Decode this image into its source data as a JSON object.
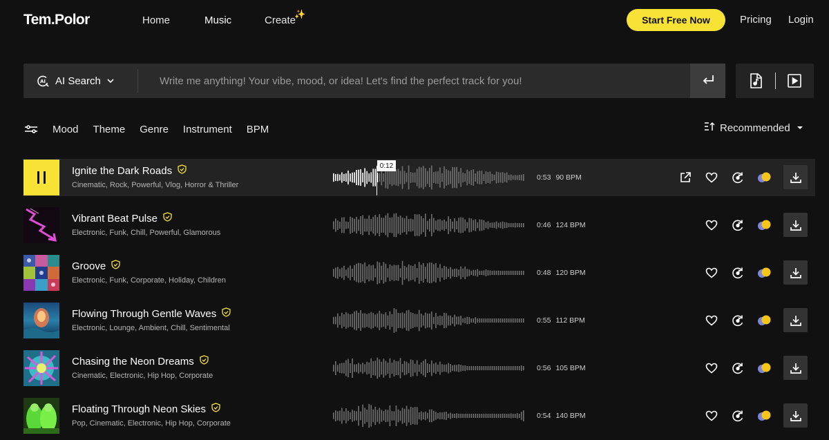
{
  "nav": {
    "logo": "Tem.Polor",
    "home": "Home",
    "music": "Music",
    "create": "Create",
    "cta": "Start Free Now",
    "pricing": "Pricing",
    "login": "Login"
  },
  "search": {
    "mode_label": "AI Search",
    "placeholder": "Write me anything! Your vibe, mood, or idea! Let's find the perfect track for you!"
  },
  "filters": [
    "Mood",
    "Theme",
    "Genre",
    "Instrument",
    "BPM"
  ],
  "sort": {
    "label": "Recommended"
  },
  "accent_color": "#f8e236",
  "player": {
    "current_time": "0:12",
    "progress": 0.23
  },
  "tracks": [
    {
      "title": "Ignite the Dark Roads",
      "tags": "Cinematic, Rock, Powerful, Vlog, Horror & Thriller",
      "duration": "0:53",
      "bpm": "90 BPM"
    },
    {
      "title": "Vibrant Beat Pulse",
      "tags": "Electronic, Funk, Chill, Powerful, Glamorous",
      "duration": "0:46",
      "bpm": "124 BPM"
    },
    {
      "title": "Groove",
      "tags": "Electronic, Funk, Corporate, Holiday, Children",
      "duration": "0:48",
      "bpm": "120 BPM"
    },
    {
      "title": "Flowing Through Gentle Waves",
      "tags": "Electronic, Lounge, Ambient, Chill, Sentimental",
      "duration": "0:55",
      "bpm": "112 BPM"
    },
    {
      "title": "Chasing the Neon Dreams",
      "tags": "Cinematic, Electronic, Hip Hop, Corporate",
      "duration": "0:56",
      "bpm": "105 BPM"
    },
    {
      "title": "Floating Through Neon Skies",
      "tags": "Pop, Cinematic, Electronic, Hip Hop, Corporate",
      "duration": "0:54",
      "bpm": "140 BPM"
    }
  ]
}
